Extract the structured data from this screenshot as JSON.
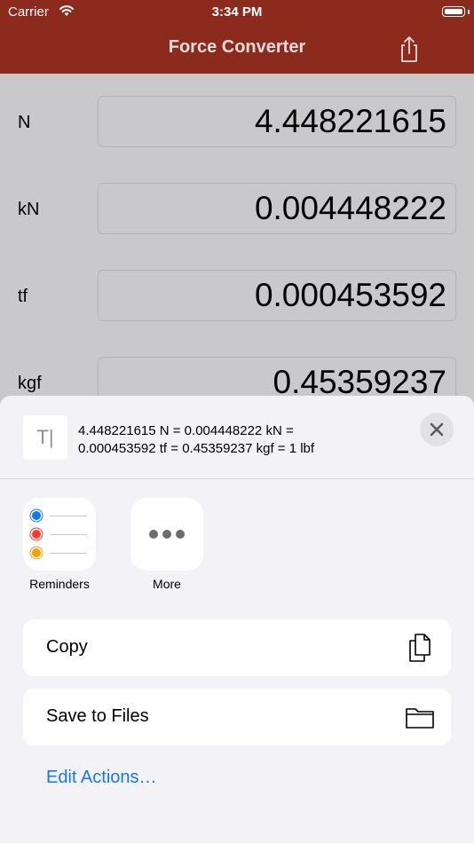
{
  "status_bar": {
    "carrier": "Carrier",
    "time": "3:34 PM"
  },
  "nav": {
    "title": "Force Converter",
    "share_icon": "share-icon"
  },
  "converter": {
    "rows": [
      {
        "unit": "N",
        "value": "4.448221615"
      },
      {
        "unit": "kN",
        "value": "0.004448222"
      },
      {
        "unit": "tf",
        "value": "0.000453592"
      },
      {
        "unit": "kgf",
        "value": "0.45359237"
      }
    ]
  },
  "share_sheet": {
    "preview_icon": "T|",
    "preview_line1": "4.448221615 N = 0.004448222 kN =",
    "preview_line2": "0.000453592 tf = 0.45359237 kgf = 1 lbf",
    "apps": [
      {
        "label": "Reminders",
        "icon": "reminders-icon"
      },
      {
        "label": "More",
        "icon": "more-icon"
      }
    ],
    "actions": [
      {
        "label": "Copy",
        "icon": "copy-icon"
      },
      {
        "label": "Save to Files",
        "icon": "folder-icon"
      }
    ],
    "edit_actions": "Edit Actions…"
  },
  "colors": {
    "nav_background": "#8c2a1e",
    "link": "#1677f3",
    "reminder_blue": "#0a7aff",
    "reminder_red": "#ff3b30",
    "reminder_orange": "#ff9f0a"
  }
}
